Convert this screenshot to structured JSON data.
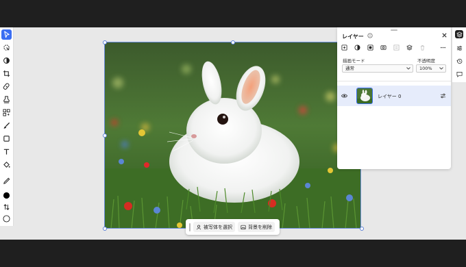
{
  "panel": {
    "title": "レイヤー",
    "blend_label": "描画モード",
    "blend_value": "通常",
    "opacity_label": "不透明度",
    "opacity_value": "100%",
    "layer_name": "レイヤー 0"
  },
  "contextbar": {
    "select_subject": "被写体を選択",
    "remove_bg": "背景を削除"
  },
  "colors": {
    "accent": "#3b6ef2",
    "chrome": "#1f1f1f",
    "workspace": "#e8e8e8",
    "foreground_swatch": "#000000",
    "background_swatch": "#ffffff"
  },
  "left_tools": [
    "select-arrow-icon",
    "quick-select-icon",
    "adjust-icon",
    "crop-icon",
    "healing-icon",
    "clone-stamp-icon",
    "generative-fill-icon",
    "brush-icon",
    "shape-icon",
    "text-icon",
    "fill-icon",
    "eyedropper-icon",
    "foreground-color",
    "swap-colors-icon",
    "background-color"
  ],
  "right_rail": [
    "layers-icon",
    "properties-icon",
    "history-icon",
    "comments-icon"
  ]
}
